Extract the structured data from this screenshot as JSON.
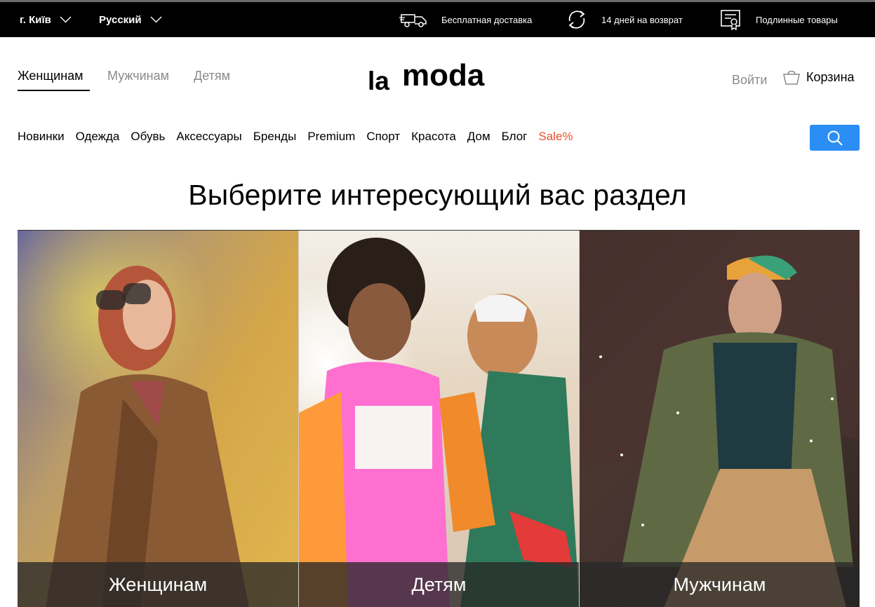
{
  "topbar": {
    "city": "г. Київ",
    "language": "Русский",
    "delivery": "Бесплатная доставка",
    "returns": "14 дней на возврат",
    "authentic": "Подлинные товары"
  },
  "header": {
    "genders": [
      "Женщинам",
      "Мужчинам",
      "Детям"
    ],
    "active_gender": "Женщинам",
    "logo_text": "lamoda",
    "login": "Войти",
    "cart": "Корзина"
  },
  "nav": {
    "items": [
      "Новинки",
      "Одежда",
      "Обувь",
      "Аксессуары",
      "Бренды",
      "Premium",
      "Спорт",
      "Красота",
      "Дом",
      "Блог"
    ],
    "sale": "Sale%"
  },
  "main": {
    "title": "Выберите интересующий вас раздел",
    "sections": [
      "Женщинам",
      "Детям",
      "Мужчинам"
    ]
  },
  "colors": {
    "search_button": "#2b8ef5",
    "sale": "#e8502c",
    "topbar": "#000000"
  },
  "icons": [
    "chevron-down-icon",
    "truck-icon",
    "refresh-icon",
    "certificate-icon",
    "bag-icon",
    "search-icon"
  ]
}
